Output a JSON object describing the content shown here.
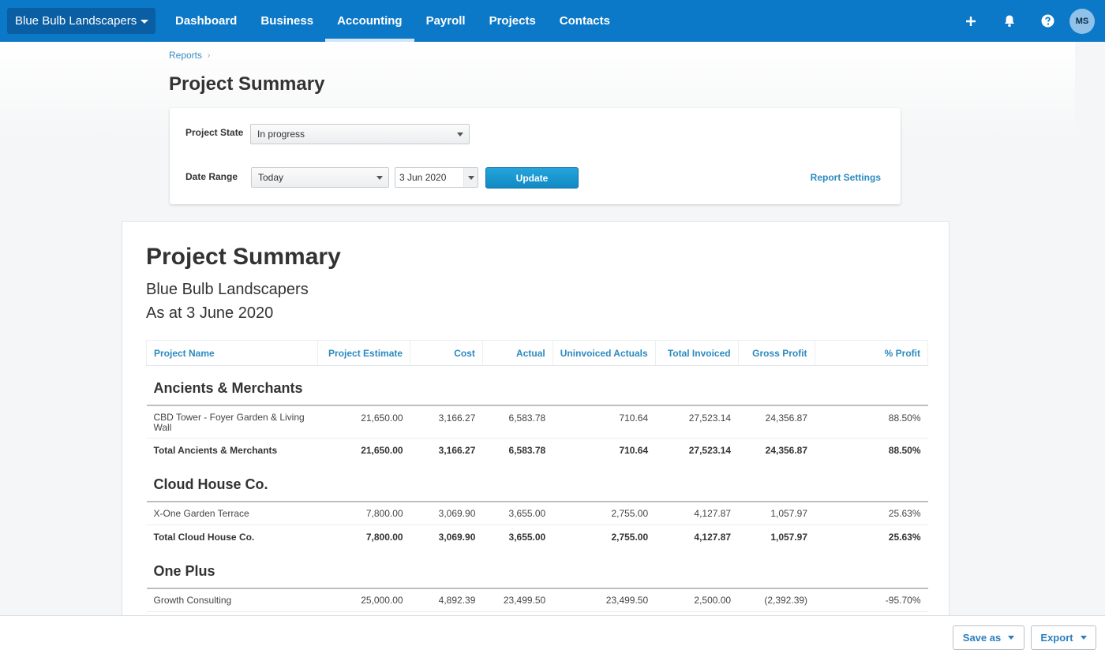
{
  "topnav": {
    "org_name": "Blue Bulb Landscapers",
    "items": [
      {
        "label": "Dashboard",
        "active": false
      },
      {
        "label": "Business",
        "active": false
      },
      {
        "label": "Accounting",
        "active": true
      },
      {
        "label": "Payroll",
        "active": false
      },
      {
        "label": "Projects",
        "active": false
      },
      {
        "label": "Contacts",
        "active": false
      }
    ],
    "icons": [
      "plus-icon",
      "bell-icon",
      "help-icon"
    ],
    "avatar_initials": "MS",
    "brand_color": "#0b78c8"
  },
  "breadcrumb": {
    "items": [
      "Reports"
    ]
  },
  "page": {
    "title": "Project Summary"
  },
  "filters": {
    "project_state_label": "Project State",
    "project_state_value": "In progress",
    "date_range_label": "Date Range",
    "date_range_value": "Today",
    "date_value": "3 Jun 2020",
    "update_label": "Update",
    "report_settings_label": "Report Settings"
  },
  "report": {
    "title": "Project Summary",
    "org": "Blue Bulb Landscapers",
    "as_at": "As at 3 June 2020",
    "columns": [
      "Project Name",
      "Project Estimate",
      "Cost",
      "Actual",
      "Uninvoiced Actuals",
      "Total Invoiced",
      "Gross Profit",
      "% Profit"
    ],
    "groups": [
      {
        "name": "Ancients & Merchants",
        "rows": [
          [
            "CBD Tower - Foyer Garden & Living Wall",
            "21,650.00",
            "3,166.27",
            "6,583.78",
            "710.64",
            "27,523.14",
            "24,356.87",
            "88.50%"
          ]
        ],
        "total": [
          "Total Ancients & Merchants",
          "21,650.00",
          "3,166.27",
          "6,583.78",
          "710.64",
          "27,523.14",
          "24,356.87",
          "88.50%"
        ]
      },
      {
        "name": "Cloud House Co.",
        "rows": [
          [
            "X-One Garden Terrace",
            "7,800.00",
            "3,069.90",
            "3,655.00",
            "2,755.00",
            "4,127.87",
            "1,057.97",
            "25.63%"
          ]
        ],
        "total": [
          "Total Cloud House Co.",
          "7,800.00",
          "3,069.90",
          "3,655.00",
          "2,755.00",
          "4,127.87",
          "1,057.97",
          "25.63%"
        ]
      },
      {
        "name": "One Plus",
        "rows": [
          [
            "Growth Consulting",
            "25,000.00",
            "4,892.39",
            "23,499.50",
            "23,499.50",
            "2,500.00",
            "(2,392.39)",
            "-95.70%"
          ]
        ]
      }
    ]
  },
  "footer": {
    "save_as_label": "Save as",
    "export_label": "Export"
  }
}
